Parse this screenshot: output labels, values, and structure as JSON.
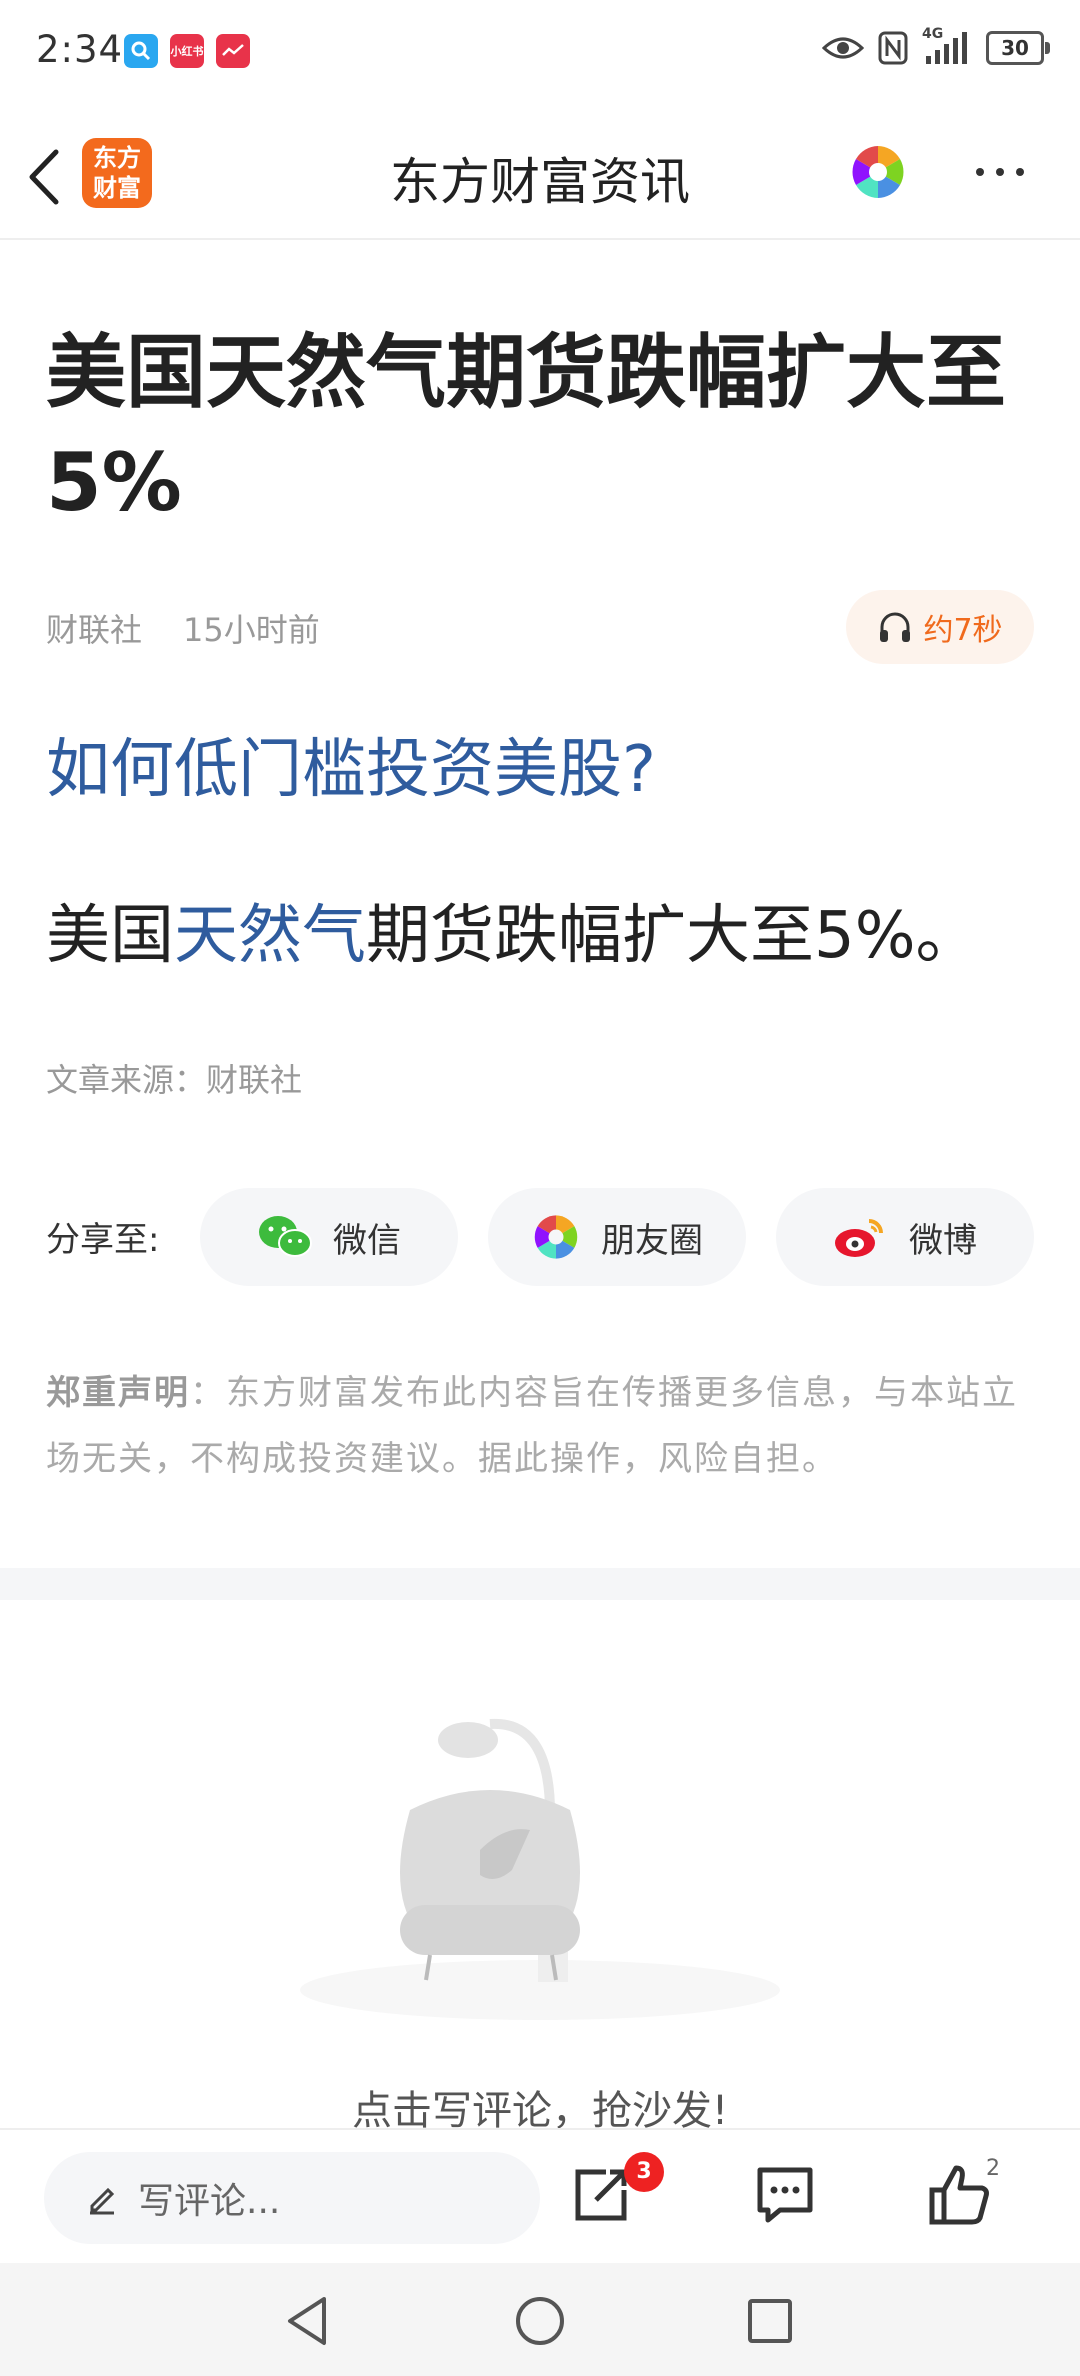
{
  "status_bar": {
    "time": "2:34",
    "apps": [
      {
        "name": "qq-browser",
        "label": "",
        "color": "#2aa7f0"
      },
      {
        "name": "xiaohongshu",
        "label": "小红书",
        "color": "#e8334a"
      },
      {
        "name": "finance-app",
        "label": "",
        "color": "#e8334a"
      }
    ],
    "network": "4G",
    "battery": "30"
  },
  "header": {
    "logo_text": "东方\n财富",
    "title": "东方财富资讯"
  },
  "article": {
    "title": "美国天然气期货跌幅扩大至5%",
    "source": "财联社",
    "time": "15小时前",
    "audio_duration": "约7秒",
    "promo_link": "如何低门槛投资美股?",
    "body_prefix": "美国",
    "body_keyword": "天然气",
    "body_suffix": "期货跌幅扩大至5%。",
    "source_line": "文章来源：财联社"
  },
  "share": {
    "label": "分享至:",
    "options": [
      {
        "label": "微信"
      },
      {
        "label": "朋友圈"
      },
      {
        "label": "微博"
      }
    ]
  },
  "disclaimer": {
    "title": "郑重声明",
    "text": "：东方财富发布此内容旨在传播更多信息，与本站立场无关，不构成投资建议。据此操作，风险自担。"
  },
  "comments": {
    "empty_text": "点击写评论，抢沙发!"
  },
  "bottom_bar": {
    "input_placeholder": "写评论...",
    "share_badge": "3",
    "like_count": "2"
  },
  "colors": {
    "brand_orange": "#f36a1d",
    "link_blue": "#2f5c9e",
    "badge_red": "#ee2222"
  }
}
